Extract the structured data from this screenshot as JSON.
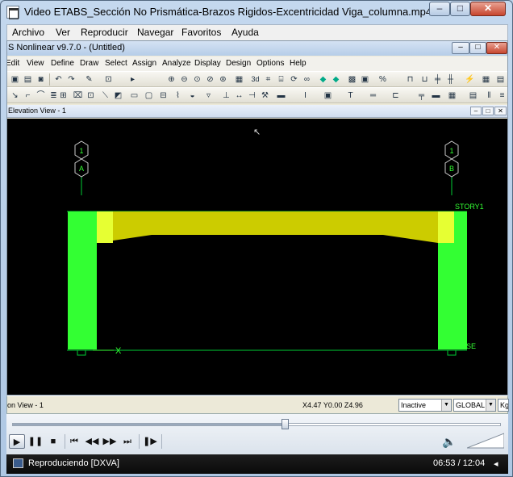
{
  "window": {
    "title": "Video ETABS_Sección No Prismática-Brazos Rigidos-Excentricidad Viga_columna.mp4",
    "minimize": "–",
    "maximize": "□",
    "close": "✕"
  },
  "player_menu": [
    "Archivo",
    "Ver",
    "Reproducir",
    "Navegar",
    "Favoritos",
    "Ayuda"
  ],
  "etabs": {
    "title": "S Nonlinear v9.7.0 - (Untitled)",
    "menu": [
      "Edit",
      "View",
      "Define",
      "Draw",
      "Select",
      "Assign",
      "Analyze",
      "Display",
      "Design",
      "Options",
      "Help"
    ],
    "toolbar_row1": [
      "save-icon",
      "print-icon",
      "camera-icon",
      "undo-icon",
      "redo-icon",
      "pencil-icon",
      "lock-icon",
      "pointer-icon",
      "zoom-in-icon",
      "zoom-out-icon",
      "zoom-window-icon",
      "pan-icon",
      "3d-view-icon",
      "plan-view-icon",
      "elevation-view-icon",
      "rotate-icon",
      "perspective-icon",
      "up-icon",
      "down-icon",
      "grid-icon",
      "shrink-icon",
      "percent-icon",
      "frame-icon",
      "bay-icon",
      "column-icon",
      "wall-icon",
      "brace-icon",
      "joint-icon"
    ],
    "toolbar_row1_label": "3d",
    "view_title": "Elevation View - 1",
    "viewport": {
      "grid_bubbles": [
        {
          "top": "1",
          "bottom": "A"
        },
        {
          "top": "1",
          "bottom": "B"
        }
      ],
      "story_label": "STORY1",
      "base_label": "SE",
      "axis_label": "X",
      "colors": {
        "column": "#33ff33",
        "beam": "#cccc00",
        "beam_end": "#e6ff33",
        "grid": "#00cc33",
        "background": "#000000"
      }
    },
    "status": {
      "view_name": "on View - 1",
      "coords": "X4.47  Y0.00  Z4.96",
      "state": "Inactive",
      "system": "GLOBAL",
      "units": "Kgf"
    }
  },
  "player": {
    "progress": 0.56,
    "buttons": [
      "play-icon",
      "pause-icon",
      "stop-icon",
      "skip-back-icon",
      "rewind-icon",
      "forward-icon",
      "skip-forward-icon",
      "frame-step-icon"
    ],
    "status_text": "Reproduciendo [DXVA]",
    "time": "06:53 / 12:04"
  }
}
